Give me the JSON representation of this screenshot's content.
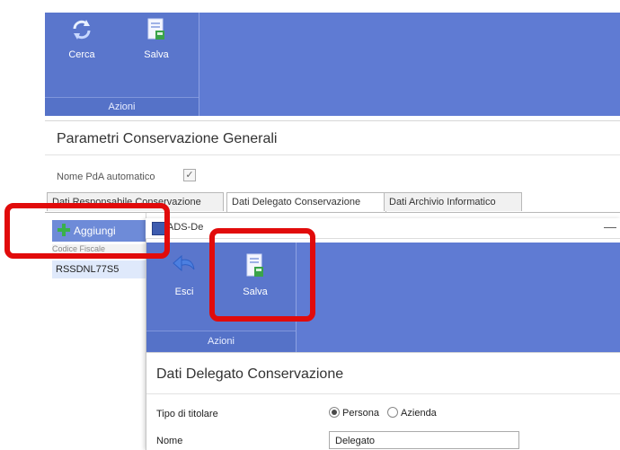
{
  "main": {
    "ribbon": {
      "buttons": [
        {
          "label": "Cerca",
          "icon": "refresh-icon"
        },
        {
          "label": "Salva",
          "icon": "save-icon"
        }
      ],
      "group_label": "Azioni"
    },
    "page_title": "Parametri Conservazione Generali",
    "field": {
      "label": "Nome PdA automatico",
      "checked": true
    },
    "tabs": [
      {
        "label": "Dati Responsabile Conservazione",
        "active": false
      },
      {
        "label": "Dati Delegato Conservazione",
        "active": true
      },
      {
        "label": "Dati Archivio Informatico",
        "active": false
      }
    ],
    "add_button": "Aggiungi",
    "column_header": "Codice Fiscale",
    "selected_row": "RSSDNL77S5"
  },
  "dialog": {
    "title": "ADS-De",
    "minimize": "—",
    "ribbon": {
      "buttons": [
        {
          "label": "Esci",
          "icon": "undo-icon"
        },
        {
          "label": "Salva",
          "icon": "save-icon"
        }
      ],
      "group_label": "Azioni"
    },
    "section_title": "Dati Delegato Conservazione",
    "form": {
      "tipo_label": "Tipo di titolare",
      "options": [
        "Persona",
        "Azienda"
      ],
      "selected_option": "Persona",
      "nome_label": "Nome",
      "nome_value": "Delegato"
    }
  },
  "colors": {
    "ribbon": "#5f7bd3",
    "highlight": "#e10b0b",
    "accent_green": "#39b14a"
  }
}
